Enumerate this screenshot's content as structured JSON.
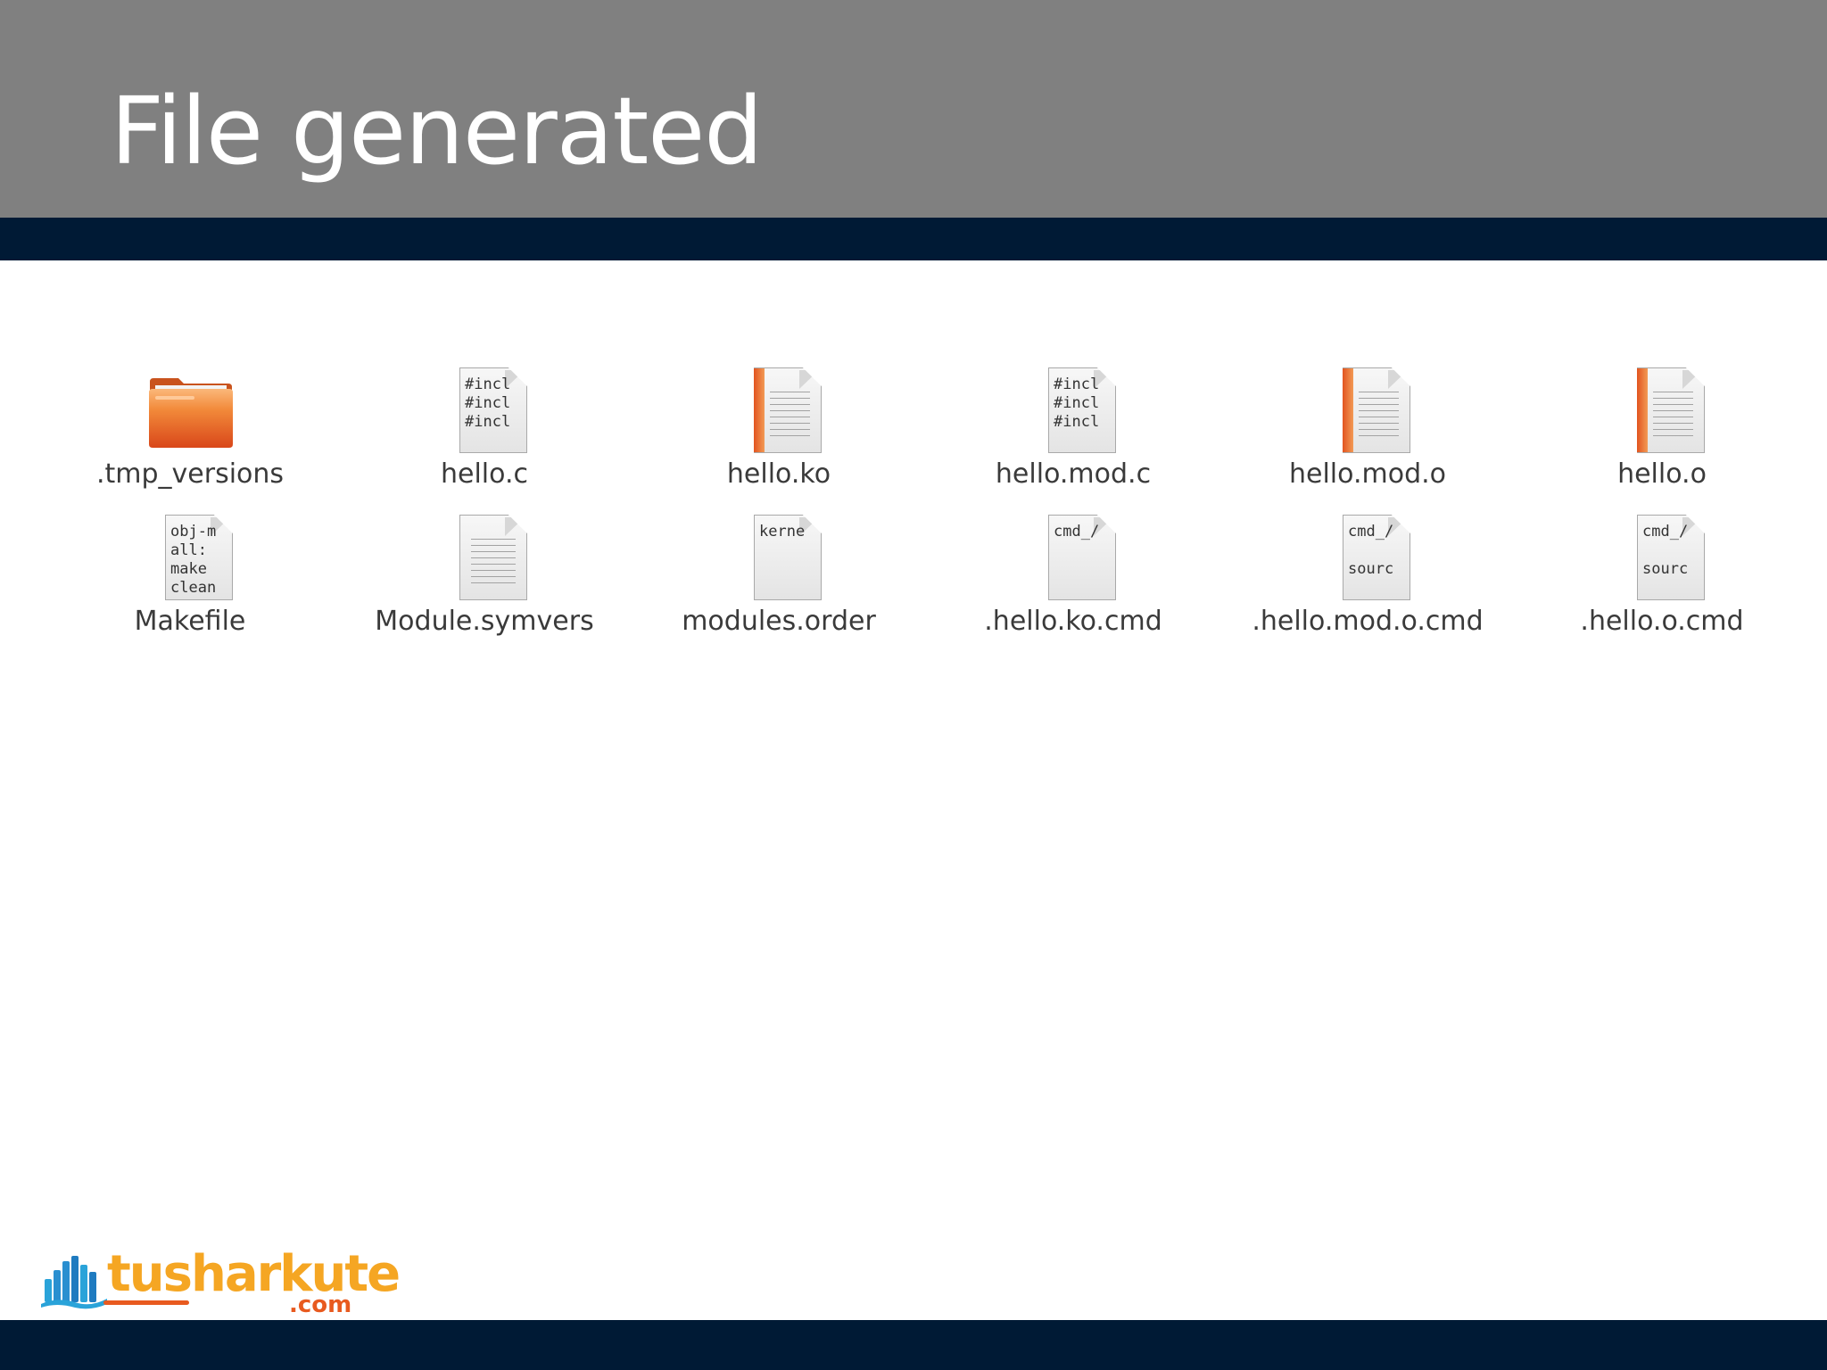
{
  "slide": {
    "title": "File generated"
  },
  "files": [
    {
      "name": ".tmp_versions",
      "icon": "folder-icon"
    },
    {
      "name": "hello.c",
      "icon": "c-source-file-icon",
      "preview": "#incl\n#incl\n#incl"
    },
    {
      "name": "hello.ko",
      "icon": "object-file-icon"
    },
    {
      "name": "hello.mod.c",
      "icon": "c-source-file-icon",
      "preview": "#incl\n#incl\n#incl"
    },
    {
      "name": "hello.mod.o",
      "icon": "object-file-icon"
    },
    {
      "name": "hello.o",
      "icon": "object-file-icon"
    },
    {
      "name": "Makefile",
      "icon": "makefile-icon",
      "preview": "obj-m\nall:\nmake\nclean"
    },
    {
      "name": "Module.symvers",
      "icon": "text-file-icon"
    },
    {
      "name": "modules.order",
      "icon": "text-file-icon",
      "preview": "kerne"
    },
    {
      "name": ".hello.ko.cmd",
      "icon": "text-file-icon",
      "preview": "cmd_/"
    },
    {
      "name": ".hello.mod.o.cmd",
      "icon": "text-file-icon",
      "preview": "cmd_/\n\nsourc"
    },
    {
      "name": ".hello.o.cmd",
      "icon": "text-file-icon",
      "preview": "cmd_/\n\nsourc"
    }
  ],
  "logo": {
    "name": "tusharkute",
    "tld": ".com"
  },
  "colors": {
    "header": "#808080",
    "rule": "#001a35",
    "folder": "#f07c2c",
    "logo_orange": "#f5a623"
  }
}
